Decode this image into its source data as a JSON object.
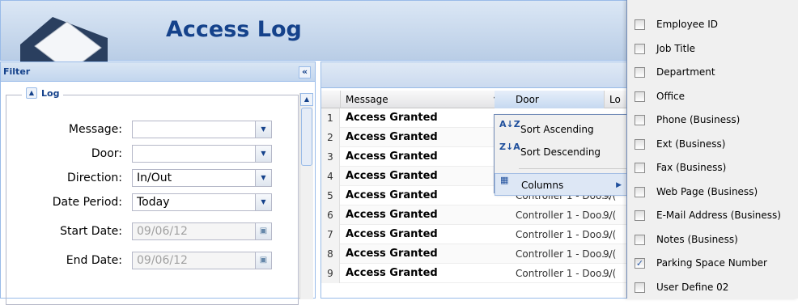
{
  "header": {
    "title": "Access Log"
  },
  "filter": {
    "title": "Filter",
    "collapse_icon": "«",
    "legend": "Log",
    "fields": [
      {
        "label": "Message:",
        "value": "",
        "type": "combo"
      },
      {
        "label": "Door:",
        "value": "",
        "type": "combo"
      },
      {
        "label": "Direction:",
        "value": "In/Out",
        "type": "combo"
      },
      {
        "label": "Date Period:",
        "value": "Today",
        "type": "combo"
      },
      {
        "label": "Start Date:",
        "value": "09/06/12",
        "type": "date",
        "disabled": true
      },
      {
        "label": "End Date:",
        "value": "09/06/12",
        "type": "date",
        "disabled": true
      }
    ]
  },
  "grid": {
    "columns": [
      "Message",
      "Door",
      "Lo"
    ],
    "rows": [
      {
        "n": "1",
        "message": "Access Granted",
        "door": "",
        "loc": ""
      },
      {
        "n": "2",
        "message": "Access Granted",
        "door": "",
        "loc": ""
      },
      {
        "n": "3",
        "message": "Access Granted",
        "door": "",
        "loc": ""
      },
      {
        "n": "4",
        "message": "Access Granted",
        "door": "",
        "loc": ""
      },
      {
        "n": "5",
        "message": "Access Granted",
        "door": "Controller 1 - Doo...",
        "loc": "9/("
      },
      {
        "n": "6",
        "message": "Access Granted",
        "door": "Controller 1 - Doo...",
        "loc": "9/("
      },
      {
        "n": "7",
        "message": "Access Granted",
        "door": "Controller 1 - Doo...",
        "loc": "9/("
      },
      {
        "n": "8",
        "message": "Access Granted",
        "door": "Controller 1 - Doo...",
        "loc": "9/("
      },
      {
        "n": "9",
        "message": "Access Granted",
        "door": "Controller 1 - Doo...",
        "loc": "9/("
      }
    ]
  },
  "column_menu": {
    "items": [
      {
        "label": "Sort Ascending",
        "icon": "sort-ascending-icon",
        "glyph": "A↓Z"
      },
      {
        "label": "Sort Descending",
        "icon": "sort-descending-icon",
        "glyph": "Z↓A"
      },
      {
        "label": "Columns",
        "icon": "columns-icon",
        "glyph": "▦"
      }
    ]
  },
  "columns_submenu": {
    "items": [
      {
        "label": "Employee ID",
        "checked": false
      },
      {
        "label": "Job Title",
        "checked": false
      },
      {
        "label": "Department",
        "checked": false
      },
      {
        "label": "Office",
        "checked": false
      },
      {
        "label": "Phone (Business)",
        "checked": false
      },
      {
        "label": "Ext (Business)",
        "checked": false
      },
      {
        "label": "Fax (Business)",
        "checked": false
      },
      {
        "label": "Web Page (Business)",
        "checked": false
      },
      {
        "label": "E-Mail Address (Business)",
        "checked": false
      },
      {
        "label": "Notes (Business)",
        "checked": false
      },
      {
        "label": "Parking Space Number",
        "checked": true
      },
      {
        "label": "User Define 02",
        "checked": false
      }
    ]
  },
  "colors": {
    "accent": "#15428b",
    "border": "#99bbe8"
  }
}
